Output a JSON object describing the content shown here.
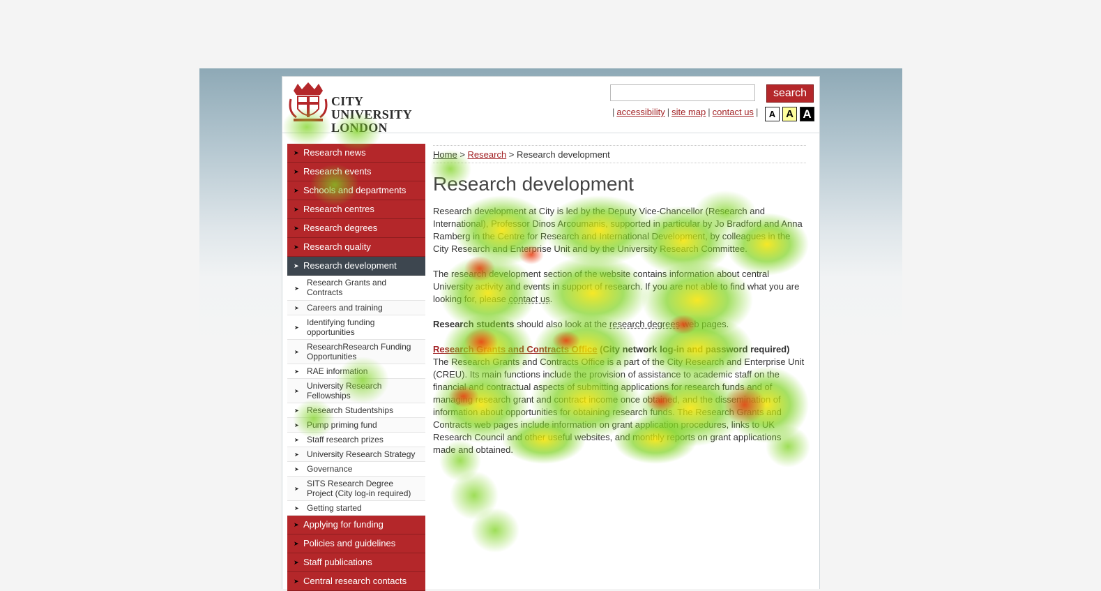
{
  "header": {
    "logo_text_line1": "CITY UNIVERSITY",
    "logo_text_line2": "LONDON",
    "search": {
      "placeholder": "",
      "value": "",
      "button_label": "search"
    },
    "utility_links": [
      "accessibility",
      "site map",
      "contact us"
    ],
    "text_size_buttons": [
      "A",
      "A",
      "A"
    ]
  },
  "sidebar": {
    "top_items": [
      "Research news",
      "Research events",
      "Schools and departments",
      "Research centres",
      "Research degrees",
      "Research quality"
    ],
    "active_item": "Research development",
    "sub_items": [
      "Research Grants and Contracts",
      "Careers and training",
      "Identifying funding opportunities",
      "ResearchResearch Funding Opportunities",
      "RAE information",
      "University Research Fellowships",
      "Research Studentships",
      "Pump priming fund",
      "Staff research prizes",
      "University Research Strategy",
      "Governance",
      "SITS Research Degree Project (City log-in required)",
      "Getting started"
    ],
    "bottom_items": [
      "Applying for funding",
      "Policies and guidelines",
      "Staff publications",
      "Central research contacts"
    ]
  },
  "breadcrumb": {
    "home": "Home",
    "sep": ">",
    "research": "Research",
    "current": "Research development"
  },
  "main": {
    "title": "Research development",
    "para1": "Research development at City is led by the Deputy Vice-Chancellor (Research and International), Professor Dinos Arcoumanis, supported in particular by Jo Bradford and Anna Ramberg in the Centre for Research and International Development, by colleagues in the City Research and Enterprise Unit and by the University Research Committee.",
    "para2_before": "The research development section of the website contains information about central University activity and events in support of research. If you are not able to find what you are looking for, please ",
    "para2_link": "contact us",
    "para2_after": ".",
    "para3_bold": "Research students",
    "para3_middle": " should also look at the ",
    "para3_link": "research degrees",
    "para3_after": " web pages.",
    "grants_link": "Research Grants and Contracts Office",
    "grants_note": " (City network log-in and password required)",
    "grants_body": "The Research Grants and Contracts Office is a part of the City Research and Enterprise Unit (CREU). Its main functions include the provision of assistance to academic staff on the financial and contractual aspects of submitting applications for research funds and of managing research grant and contract income once obtained, and the dissemination of information about opportunities for obtaining research funds. The Research Grants and Contracts web pages include information on grant application procedures, links to UK Research Council and other useful websites, and monthly reports on grant applications made and obtained."
  },
  "colors": {
    "brand_red": "#b4272a",
    "nav_active": "#3d464f",
    "heat_low": "#7ed321",
    "heat_mid": "#f5e400",
    "heat_high": "#ea3a10"
  }
}
